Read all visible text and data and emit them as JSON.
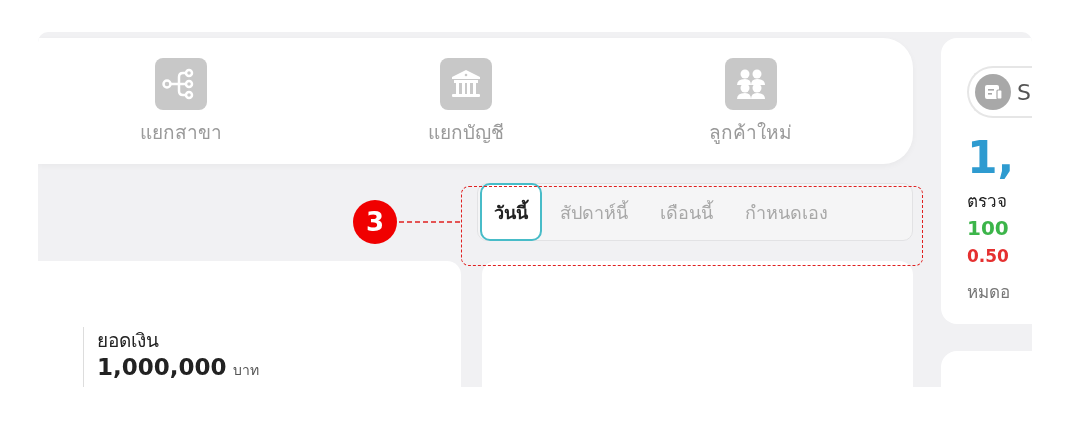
{
  "shortcuts": [
    {
      "kind": "branch",
      "label": "แยกสาขา"
    },
    {
      "kind": "bank",
      "label": "แยกบัญชี"
    },
    {
      "kind": "people",
      "label": "ลูกค้าใหม่"
    }
  ],
  "period_tabs": [
    {
      "label": "วันนี้",
      "selected": true
    },
    {
      "label": "สัปดาห์นี้",
      "selected": false
    },
    {
      "label": "เดือนนี้",
      "selected": false
    },
    {
      "label": "กำหนดเอง",
      "selected": false
    }
  ],
  "annotation": {
    "number": "3"
  },
  "balance_card": {
    "label": "ยอดเงิน",
    "amount": "1,000,000",
    "unit": "บาท"
  },
  "side_card": {
    "badge": "S",
    "total": "1,",
    "line_1": "ตรวจ",
    "line_2": "100",
    "line_3": "0.50",
    "line_4": "หมดอ"
  }
}
